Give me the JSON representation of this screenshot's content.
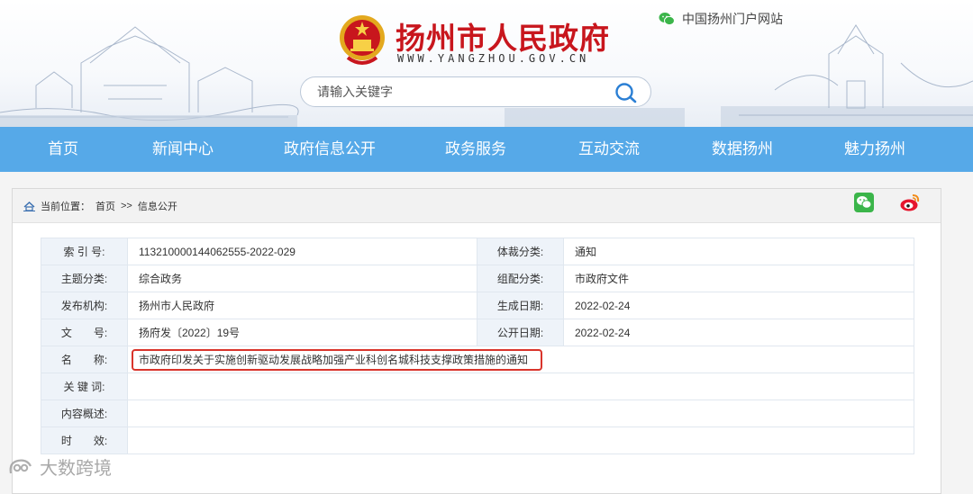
{
  "header": {
    "site_title": "扬州市人民政府",
    "site_domain": "WWW.YANGZHOU.GOV.CN",
    "portal_link": "中国扬州门户网站",
    "search_placeholder": "请输入关键字"
  },
  "nav": {
    "items": [
      {
        "label": "首页"
      },
      {
        "label": "新闻中心"
      },
      {
        "label": "政府信息公开"
      },
      {
        "label": "政务服务"
      },
      {
        "label": "互动交流"
      },
      {
        "label": "数据扬州"
      },
      {
        "label": "魅力扬州"
      }
    ]
  },
  "breadcrumb": {
    "prefix": "当前位置：",
    "home": "首页",
    "separator": ">>",
    "current": "信息公开"
  },
  "info": {
    "index_label": "索 引 号:",
    "index_value": "113210000144062555-2022-029",
    "genre_label": "体裁分类:",
    "genre_value": "通知",
    "topic_label": "主题分类:",
    "topic_value": "综合政务",
    "org_class_label": "组配分类:",
    "org_class_value": "市政府文件",
    "publisher_label": "发布机构:",
    "publisher_value": "扬州市人民政府",
    "created_label": "生成日期:",
    "created_value": "2022-02-24",
    "docno_label": "文　　号:",
    "docno_value": "扬府发〔2022〕19号",
    "published_label": "公开日期:",
    "published_value": "2022-02-24",
    "name_label": "名　　称:",
    "name_value": "市政府印发关于实施创新驱动发展战略加强产业科创名城科技支撑政策措施的通知",
    "keywords_label": "关 键 词:",
    "keywords_value": "",
    "summary_label": "内容概述:",
    "summary_value": "",
    "validity_label": "时　　效:",
    "validity_value": ""
  },
  "watermark": {
    "text": "大数跨境"
  },
  "colors": {
    "nav_bg": "#56a9e8",
    "title_red": "#c8161d",
    "highlight_red": "#d9342b",
    "label_bg": "#eef3f9",
    "wechat_green": "#3bb54a",
    "weibo_red": "#e6162d"
  },
  "icons": {
    "search": "search-icon",
    "wechat": "wechat-icon",
    "weibo": "weibo-icon",
    "home": "home-icon",
    "emblem": "national-emblem-icon"
  }
}
